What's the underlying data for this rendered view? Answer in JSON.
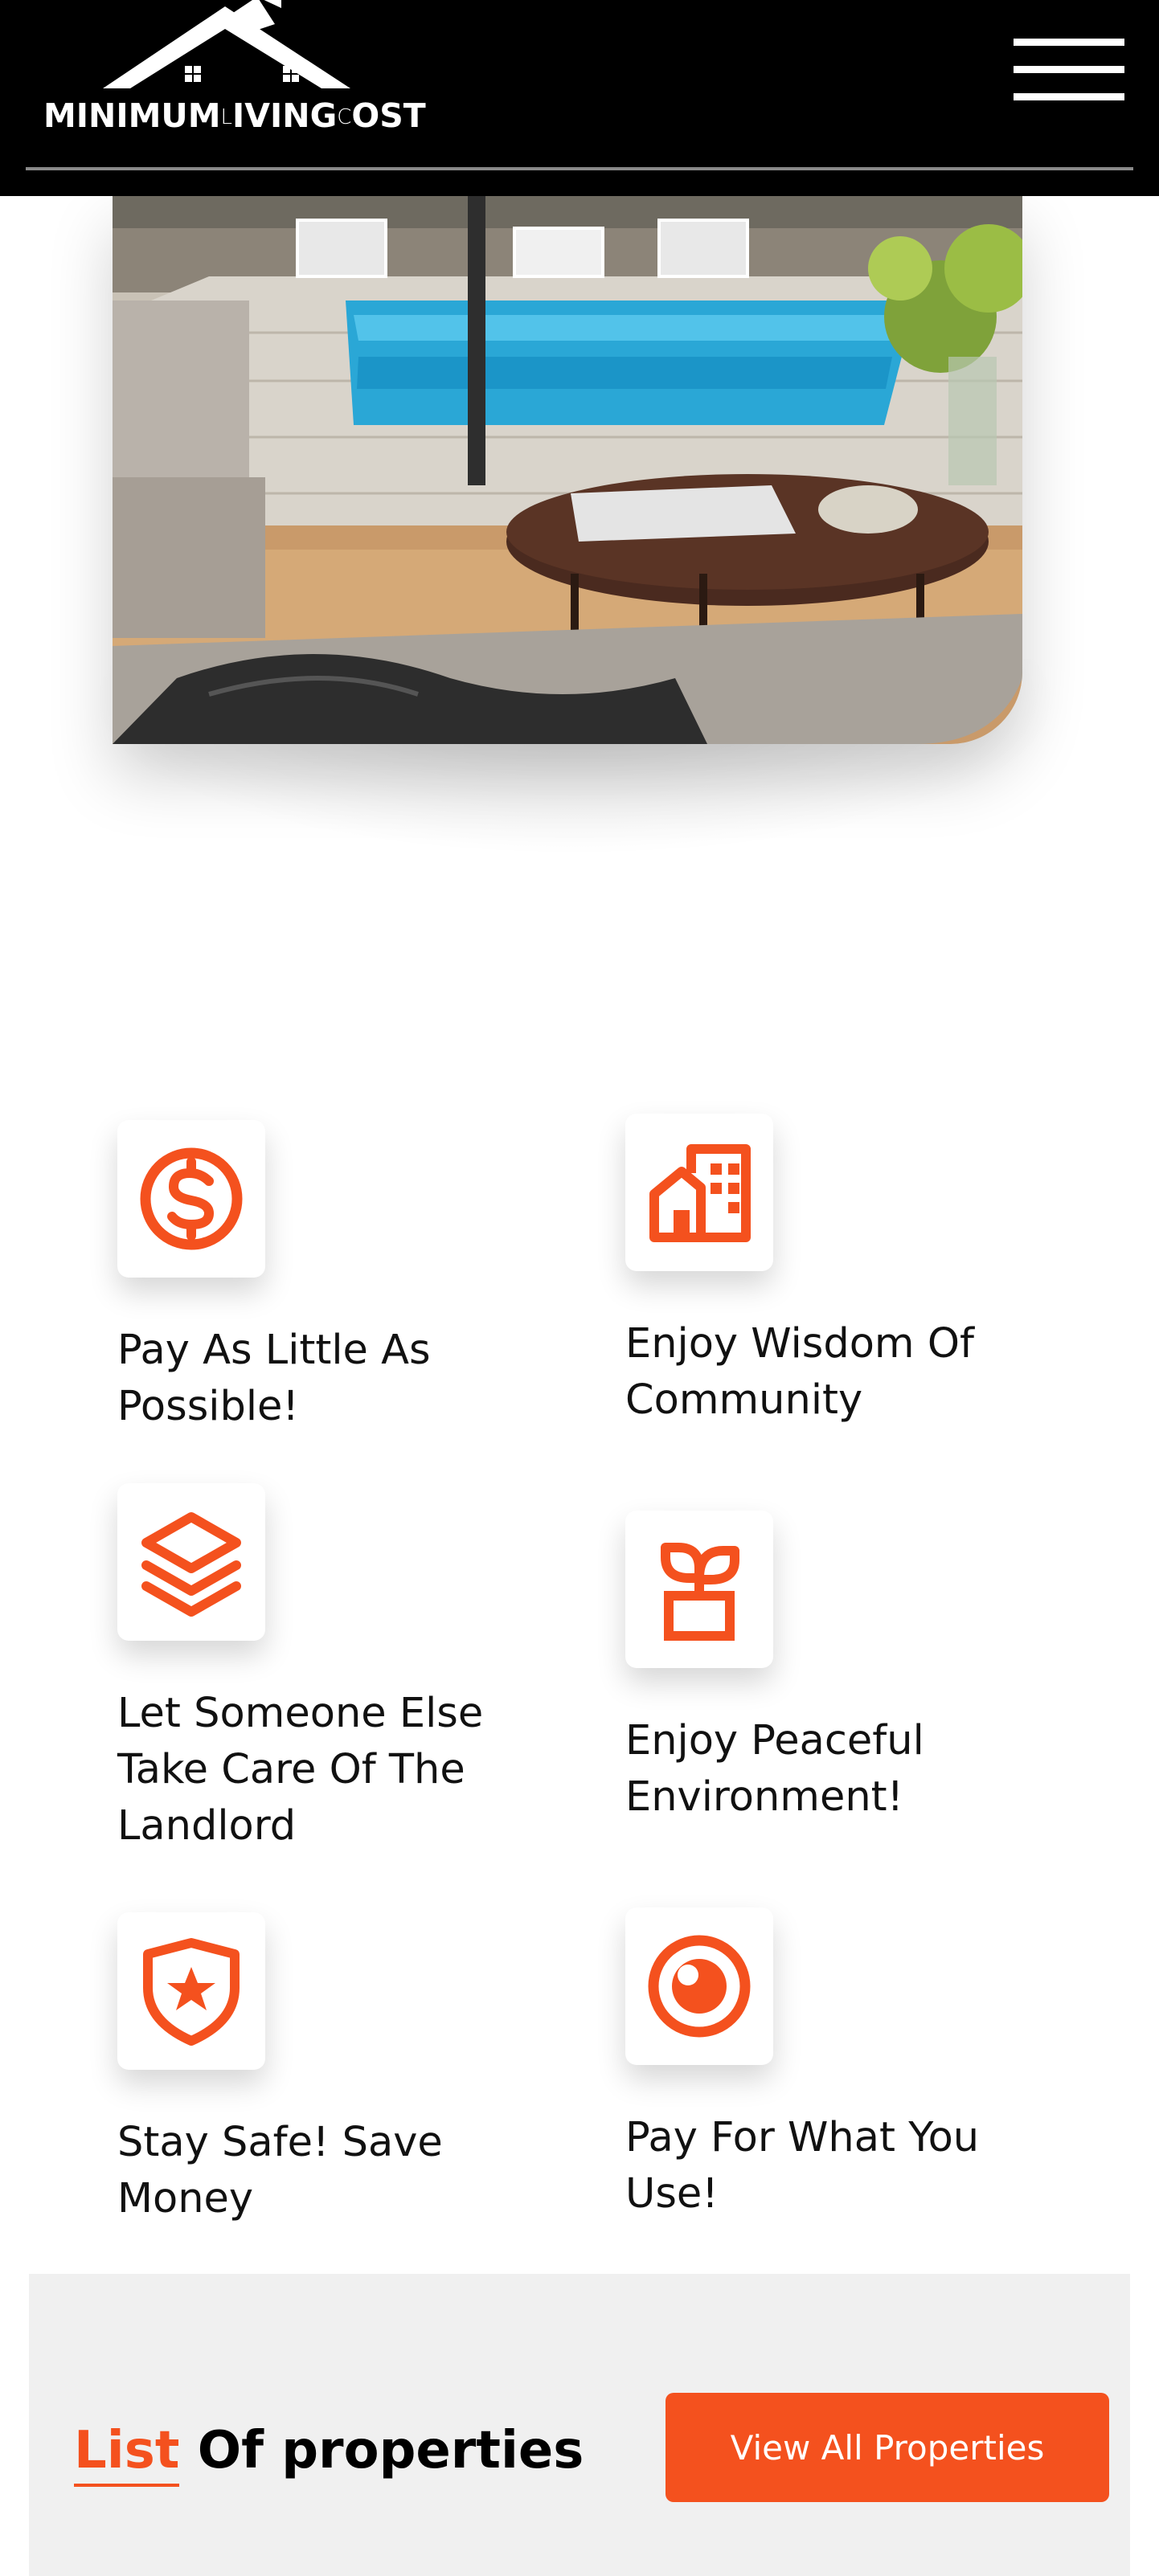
{
  "header": {
    "logo_text_1": "MINIMUM",
    "logo_text_mini": "L",
    "logo_text_2": "IVING",
    "logo_text_mini2": "C",
    "logo_text_3": "OST",
    "menu_icon": "hamburger-icon"
  },
  "hero": {
    "image_subject": "living room overlooking swimming pool"
  },
  "features": [
    {
      "title": "Pay As Little As Possible!",
      "icon": "dollar-circle-icon"
    },
    {
      "title": "Enjoy Wisdom Of Community",
      "icon": "buildings-icon"
    },
    {
      "title": "Let Someone Else Take Care Of The Landlord",
      "icon": "layers-icon"
    },
    {
      "title": "Enjoy Peaceful Environment!",
      "icon": "plant-pot-icon"
    },
    {
      "title": "Stay Safe! Save Money",
      "icon": "shield-star-icon"
    },
    {
      "title": "Pay For What You Use!",
      "icon": "eye-circle-icon"
    }
  ],
  "list_section": {
    "heading_accent": "List",
    "heading_rest": " Of properties",
    "button_label": "View All Properties"
  },
  "colors": {
    "accent": "#f4511e",
    "header_bg": "#000000",
    "section_bg": "#f0f0f0"
  }
}
